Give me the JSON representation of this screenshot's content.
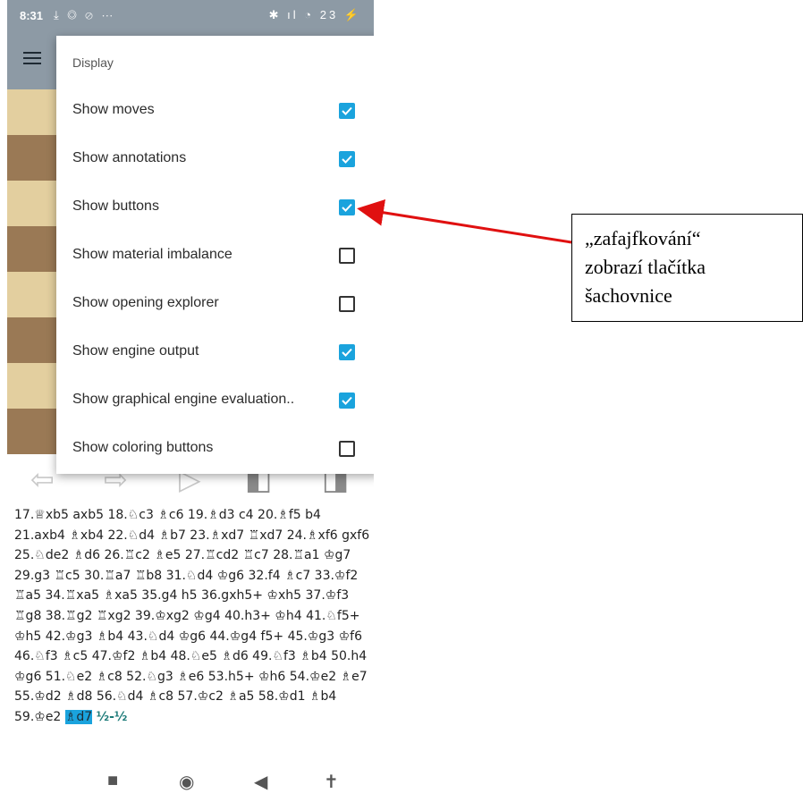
{
  "status_bar": {
    "time": "8:31",
    "left_icons": "⤓ ◎ ⊘ ⋯",
    "right_icons": "✱ ıl ◔ 23 ⚡",
    "background": "#8d9aa5"
  },
  "app_bar": {
    "menu_icon": "hamburger-icon"
  },
  "menu": {
    "header": "Display",
    "items": [
      {
        "label": "Show moves",
        "checked": true
      },
      {
        "label": "Show annotations",
        "checked": true
      },
      {
        "label": "Show buttons",
        "checked": true
      },
      {
        "label": "Show material imbalance",
        "checked": false
      },
      {
        "label": "Show opening explorer",
        "checked": false
      },
      {
        "label": "Show engine output",
        "checked": true
      },
      {
        "label": "Show graphical engine evaluation..",
        "checked": true
      },
      {
        "label": "Show coloring buttons",
        "checked": false
      }
    ],
    "accent": "#1aa3dd"
  },
  "nav_buttons": [
    "back-arrow-icon",
    "forward-arrow-icon",
    "play-icon",
    "flip-board-left-icon",
    "flip-board-right-icon"
  ],
  "moves": {
    "text": "17.♕xb5 axb5 18.♘c3 ♗c6 19.♗d3 c4 20.♗f5 b4 21.axb4 ♗xb4 22.♘d4 ♗b7 23.♗xd7 ♖xd7 24.♗xf6 gxf6 25.♘de2 ♗d6 26.♖c2 ♗e5 27.♖cd2 ♖c7 28.♖a1 ♔g7 29.g3 ♖c5 30.♖a7 ♖b8 31.♘d4 ♔g6 32.f4 ♗c7 33.♔f2 ♖a5 34.♖xa5 ♗xa5 35.g4 h5 36.gxh5+ ♔xh5 37.♔f3 ♖g8 38.♖g2 ♖xg2 39.♔xg2 ♔g4 40.h3+ ♔h4 41.♘f5+ ♔h5 42.♔g3 ♗b4 43.♘d4 ♔g6 44.♔g4 f5+ 45.♔g3 ♔f6 46.♘f3 ♗c5 47.♔f2 ♗b4 48.♘e5 ♗d6 49.♘f3 ♗b4 50.h4 ♔g6 51.♘e2 ♗c8 52.♘g3 ♗e6 53.h5+ ♔h6 54.♔e2 ♗e7 55.♔d2 ♗d8 56.♘d4 ♗c8 57.♔c2 ♗a5 58.♔d1 ♗b4 59.♔e2 ",
    "last_move": "♗d7",
    "result": "½-½"
  },
  "system_nav": {
    "recent": "■",
    "home": "◉",
    "back": "◀",
    "accessibility": "✝"
  },
  "callout": {
    "lines": [
      "„zafajfkování“",
      "zobrazí tlačítka",
      "šachovnice"
    ],
    "arrow_color": "#e01010"
  }
}
